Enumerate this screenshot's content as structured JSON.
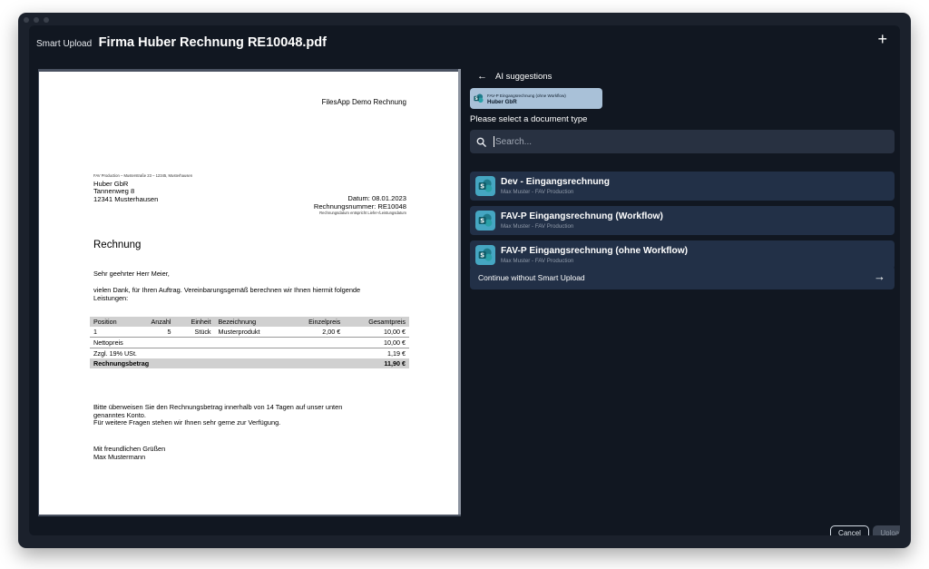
{
  "modal": {
    "title_prefix": "Smart Upload",
    "title": "Firma Huber Rechnung RE10048.pdf",
    "plus_icon": "+"
  },
  "document": {
    "header": "FilesApp Demo Rechnung",
    "sender_line": "FAV Production – Musterstraße 23 – 12345, Musterhausen",
    "recipient": [
      "Huber GbR",
      "Tannenweg 8",
      "12341 Musterhausen"
    ],
    "date_line": "Datum: 08.01.2023",
    "number_line": "Rechnungsnummer: RE10048",
    "date_note": "Rechnungsdatum entspricht Liefer-/Leistungsdatum",
    "heading": "Rechnung",
    "greeting": "Sehr geehrter Herr Meier,",
    "intro_1": "vielen Dank, für Ihren Auftrag. Vereinbarungsgemäß berechnen wir Ihnen hiermit folgende",
    "intro_2": "Leistungen:",
    "table": {
      "headers": [
        "Position",
        "Anzahl",
        "Einheit",
        "Bezeichnung",
        "Einzelpreis",
        "Gesamtpreis"
      ],
      "row": [
        "1",
        "5",
        "Stück",
        "Musterprodukt",
        "2,00 €",
        "10,00 €"
      ],
      "net_label": "Nettopreis",
      "net_value": "10,00 €",
      "tax_label": "Zzgl. 19% USt.",
      "tax_value": "1,19 €",
      "total_label": "Rechnungsbetrag",
      "total_value": "11,90 €"
    },
    "outro_1": "Bitte überweisen Sie den Rechnungsbetrag innerhalb von 14 Tagen auf unser unten",
    "outro_2": "genanntes Konto.",
    "outro_3": "Für weitere Fragen stehen wir Ihnen sehr gerne zur Verfügung.",
    "closing_1": "Mit freundlichen Grüßen",
    "closing_2": "Max Mustermann"
  },
  "ai": {
    "back_icon": "←",
    "title": "AI suggestions",
    "chip": {
      "subtitle": "FAV-P Eingangsrechnung (ohne Workflow)",
      "title": "Huber GbR"
    },
    "select_label": "Please select a document type",
    "search_placeholder": "Search...",
    "types": [
      {
        "title": "Dev - Eingangsrechnung",
        "subtitle": "Max Muster - FAV Production"
      },
      {
        "title": "FAV-P Eingangsrechnung (Workflow)",
        "subtitle": "Max Muster - FAV Production"
      },
      {
        "title": "FAV-P Eingangsrechnung (ohne Workflow)",
        "subtitle": "Max Muster - FAV Production"
      }
    ],
    "continue_label": "Continue without Smart Upload",
    "continue_arrow": "→"
  },
  "footer": {
    "cancel": "Cancel",
    "upload": "Upload"
  },
  "colors": {
    "accent": "#45a6c2",
    "chip": "#a9c1d8",
    "item_bg": "#223047",
    "modal_bg": "#111721"
  },
  "icons": {
    "type_icon": "sharepoint-document-icon",
    "search": "search-icon",
    "back": "arrow-left-icon",
    "continue": "arrow-right-icon"
  }
}
